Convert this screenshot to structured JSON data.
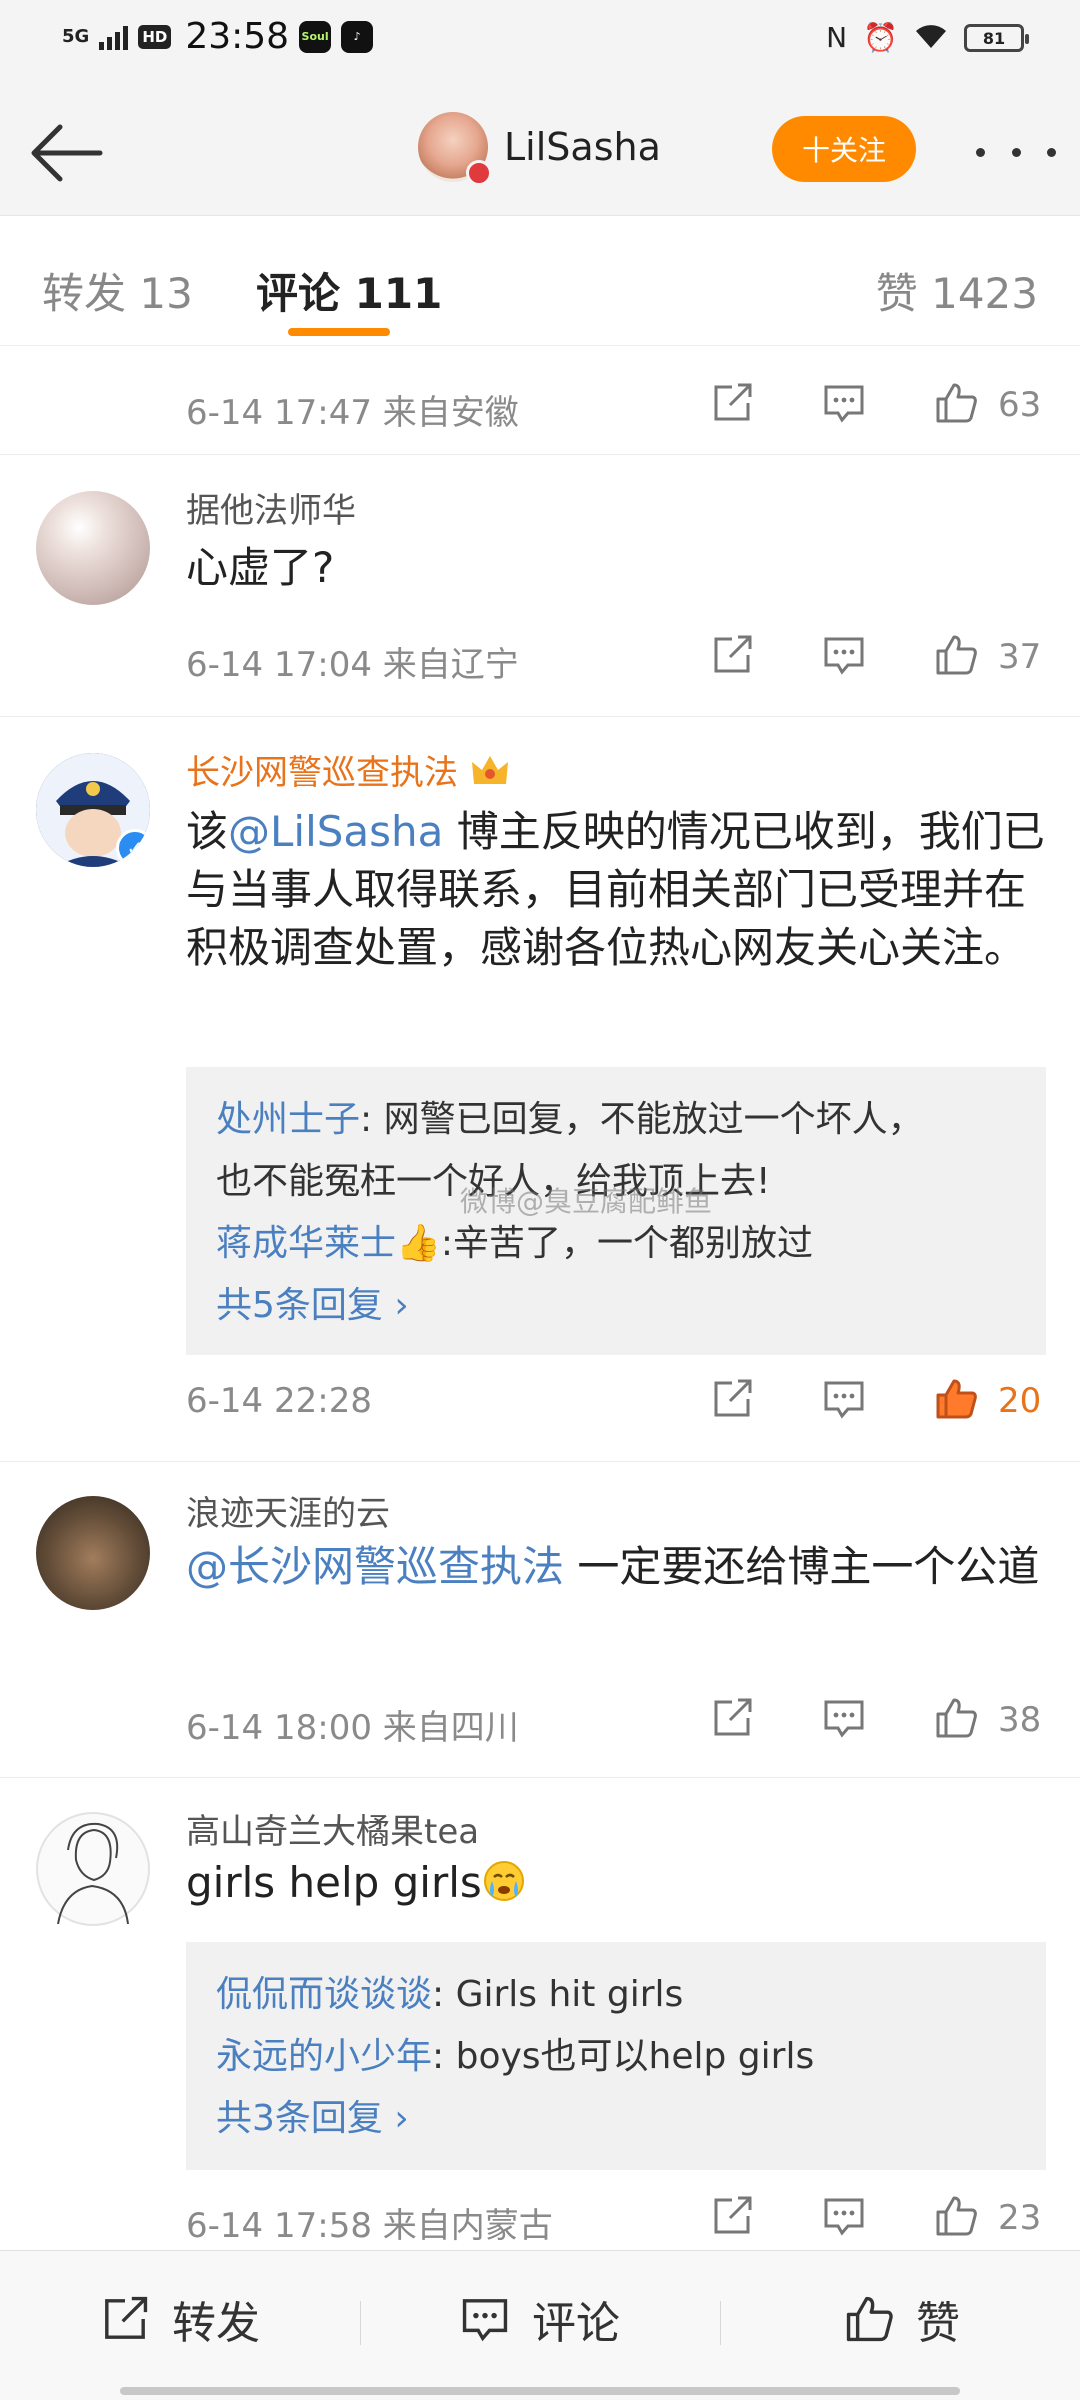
{
  "status_bar": {
    "network": "5G",
    "hd": "HD",
    "time": "23:58",
    "battery": "81",
    "apps": [
      "Soul",
      "TikTok"
    ],
    "icons": [
      "nfc-icon",
      "alarm-icon",
      "wifi-icon"
    ]
  },
  "header": {
    "name": "LilSasha",
    "follow_label": "十关注"
  },
  "tabs": {
    "repost": "转发 13",
    "comment": "评论 111",
    "like": "赞 1423"
  },
  "comments": [
    {
      "meta": {
        "time": "6-14 17:47 来自安徽",
        "likes": "63"
      }
    },
    {
      "name": "据他法师华",
      "text": "心虚了?",
      "meta": {
        "time": "6-14 17:04 来自辽宁",
        "likes": "37"
      }
    },
    {
      "name": "长沙网警巡查执法",
      "text_prefix": "该",
      "mention": "@LilSasha",
      "text_suffix": " 博主反映的情况已收到，我们已与当事人取得联系，目前相关部门已受理并在积极调查处置，感谢各位热心网友关心关注。",
      "replies": [
        {
          "user": "处州士子",
          "text": ": 网警已回复，不能放过一个坏人，",
          "text2": "也不能冤枉一个好人，给我顶上去!"
        },
        {
          "user": "蒋成华莱士",
          "text": ":辛苦了，一个都别放过"
        }
      ],
      "reply_more": "共5条回复 ›",
      "meta": {
        "time": "6-14 22:28",
        "likes": "20"
      }
    },
    {
      "name": "浪迹天涯的云",
      "mention": "@长沙网警巡查执法",
      "text_suffix": " 一定要还给博主一个公道",
      "meta": {
        "time": "6-14 18:00 来自四川",
        "likes": "38"
      }
    },
    {
      "name": "高山奇兰大橘果tea",
      "text": "girls help girls",
      "replies": [
        {
          "user": "侃侃而谈谈谈",
          "text": ": Girls hit girls"
        },
        {
          "user": "永远的小少年",
          "text": ": boys也可以help girls"
        }
      ],
      "reply_more": "共3条回复 ›",
      "meta": {
        "time": "6-14 17:58 来自内蒙古",
        "likes": "23"
      }
    }
  ],
  "watermark": "微博@臭豆腐配鲱鱼",
  "bottom_bar": {
    "repost": "转发",
    "comment": "评论",
    "like": "赞"
  }
}
